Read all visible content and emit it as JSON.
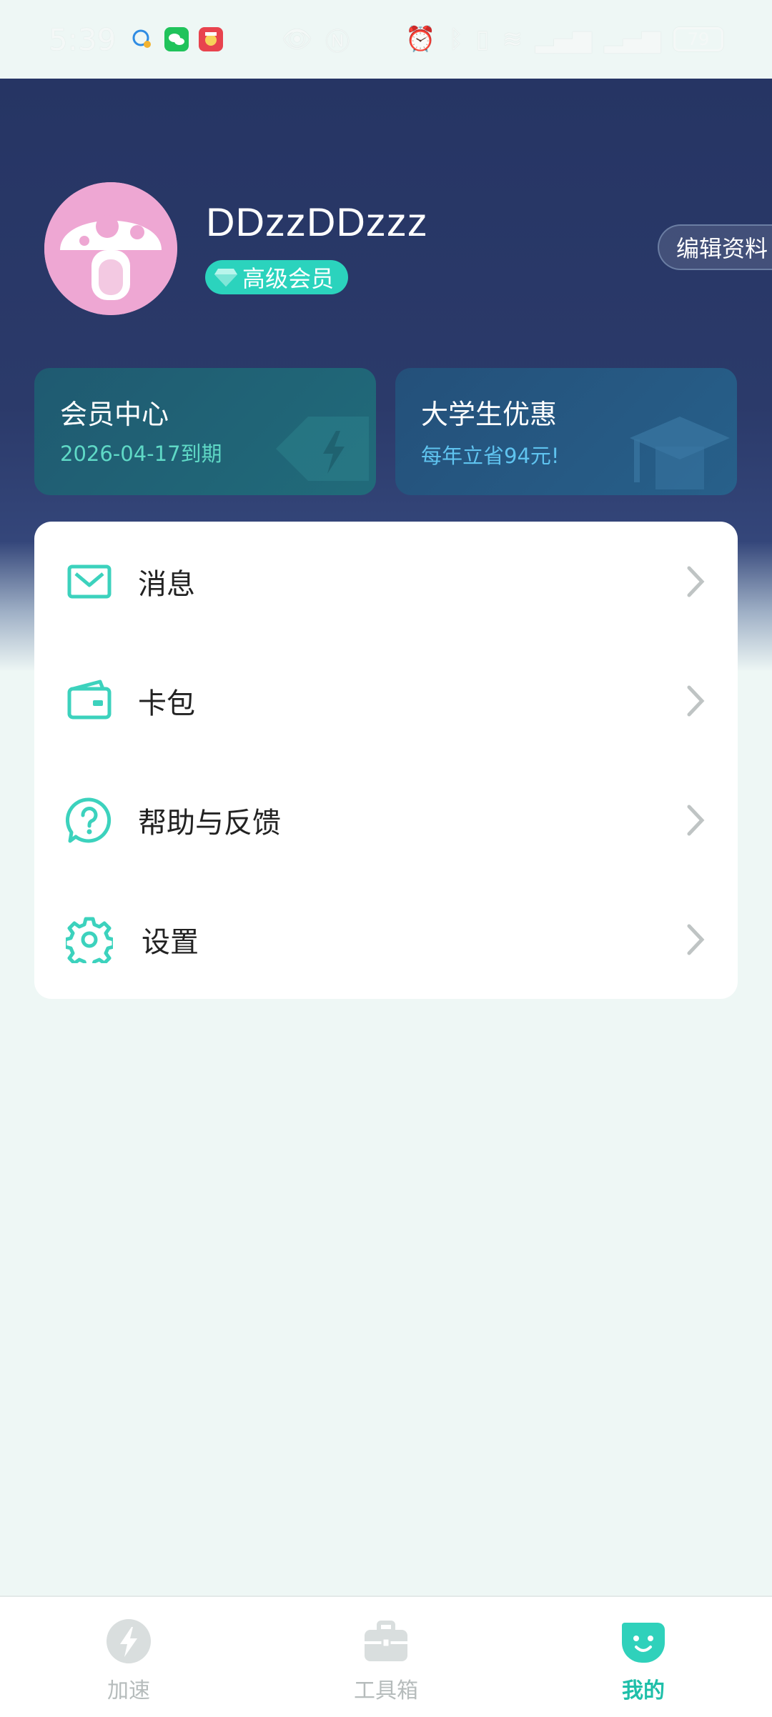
{
  "status_bar": {
    "time": "5:39",
    "battery": "79",
    "icons": [
      "qq-icon",
      "wechat-icon",
      "app-icon",
      "eye-icon",
      "nfc-icon",
      "alarm-icon",
      "bluetooth-icon",
      "vibrate-icon",
      "wifi-icon",
      "signal-icon",
      "signal-icon",
      "battery-icon"
    ]
  },
  "profile": {
    "username": "DDzzDDzzz",
    "vip_label": "高级会员",
    "edit_label": "编辑资料"
  },
  "cards": {
    "member": {
      "title": "会员中心",
      "subtitle": "2026-04-17到期"
    },
    "student": {
      "title": "大学生优惠",
      "subtitle": "每年立省94元!"
    }
  },
  "menu": {
    "items": [
      {
        "label": "消息",
        "icon": "envelope-icon"
      },
      {
        "label": "卡包",
        "icon": "wallet-icon"
      },
      {
        "label": "帮助与反馈",
        "icon": "help-icon"
      },
      {
        "label": "设置",
        "icon": "gear-icon"
      }
    ]
  },
  "nav": {
    "tabs": [
      {
        "label": "加速",
        "icon": "lightning-icon",
        "active": false
      },
      {
        "label": "工具箱",
        "icon": "toolbox-icon",
        "active": false
      },
      {
        "label": "我的",
        "icon": "smiley-icon",
        "active": true
      }
    ]
  },
  "colors": {
    "accent": "#2bd3bd",
    "header_top": "#263564",
    "background": "#eef7f5",
    "inactive_nav": "#b6bcbc"
  }
}
